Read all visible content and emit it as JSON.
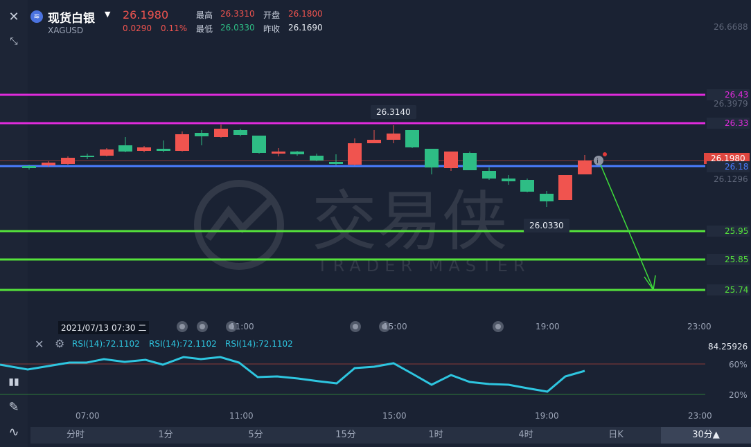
{
  "instrument": {
    "name": "现货白银",
    "code": "XAGUSD",
    "last_price": "26.1980",
    "change": "0.0290",
    "change_pct": "0.11%",
    "high_label": "最高",
    "high": "26.3310",
    "low_label": "最低",
    "low": "26.0330",
    "open_label": "开盘",
    "open": "26.1800",
    "prev_close_label": "昨收",
    "prev_close": "26.1690"
  },
  "price_axis": {
    "top": "26.6688",
    "mid_upper": "26.3979",
    "current": "26.1980",
    "mid_lower": "26.1296"
  },
  "level_tags": [
    {
      "label": "26.43",
      "color": "#e02bdc"
    },
    {
      "label": "26.33",
      "color": "#e02bdc"
    },
    {
      "label": "26.18",
      "color": "#4a7dff"
    },
    {
      "label": "25.95",
      "color": "#55e33b"
    },
    {
      "label": "25.85",
      "color": "#55e33b"
    },
    {
      "label": "25.74",
      "color": "#55e33b"
    }
  ],
  "callouts": {
    "high": "26.3140",
    "low": "26.0330"
  },
  "watermark": {
    "main": "交易侠",
    "sub": "TRADER MASTER"
  },
  "crosshair_time": "2021/07/13 07:30 二",
  "main_time_labels": [
    "11:00",
    "15:00",
    "19:00",
    "23:00"
  ],
  "indicator": {
    "rsi_labels": [
      "RSI(14):72.1102",
      "RSI(14):72.1102",
      "RSI(14):72.1102"
    ],
    "axis_top": "84.25926",
    "level_60": "60%",
    "level_20": "20%"
  },
  "bottom_time_labels": [
    "07:00",
    "11:00",
    "15:00",
    "19:00",
    "23:00"
  ],
  "tabs": [
    "分时",
    "1分",
    "5分",
    "15分",
    "1时",
    "4时",
    "日K",
    "30分▲"
  ],
  "colors": {
    "up": "#f0544f",
    "down": "#2ebd85",
    "background": "#1a2233",
    "rsi_line": "#2ec6e0"
  }
}
